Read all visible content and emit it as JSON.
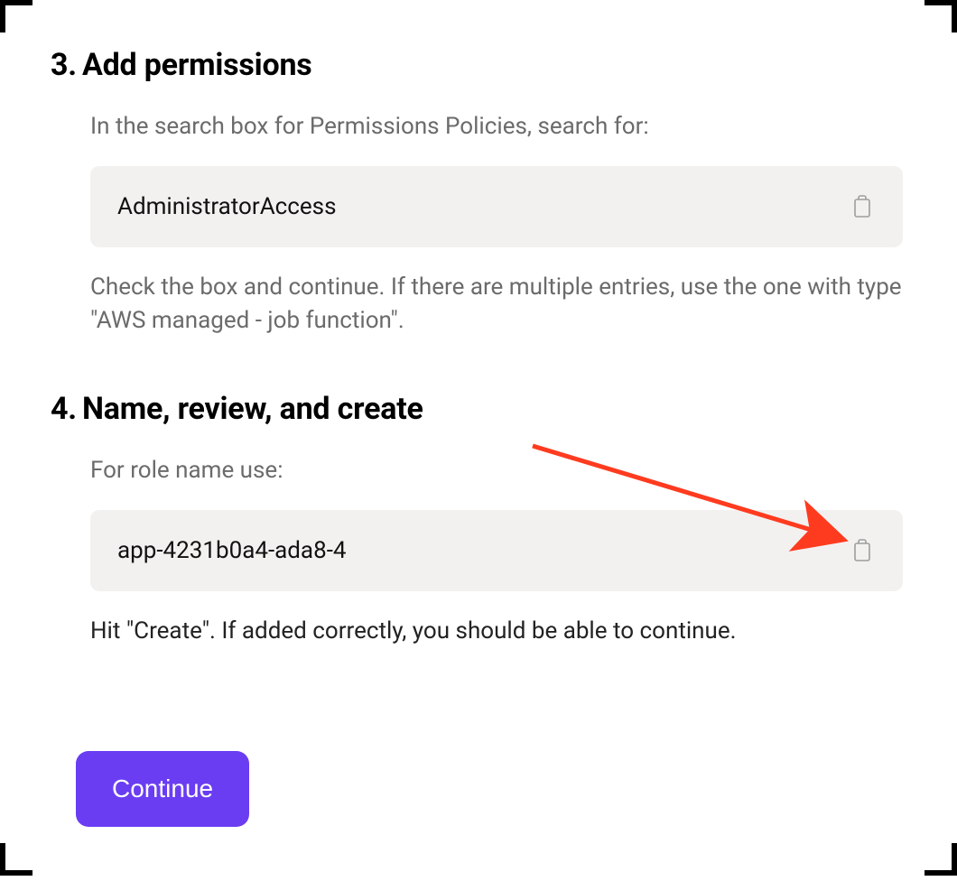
{
  "steps": {
    "s3": {
      "number": "3.",
      "title": "Add permissions",
      "intro": "In the search box for Permissions Policies, search for:",
      "code": "AdministratorAccess",
      "after": "Check the box and continue. If there are multiple entries, use the one with type \"AWS managed - job function\"."
    },
    "s4": {
      "number": "4.",
      "title": "Name, review, and create",
      "intro": "For role name use:",
      "code": "app-4231b0a4-ada8-4",
      "after": "Hit \"Create\". If added correctly, you should be able to continue."
    }
  },
  "continue_label": "Continue"
}
